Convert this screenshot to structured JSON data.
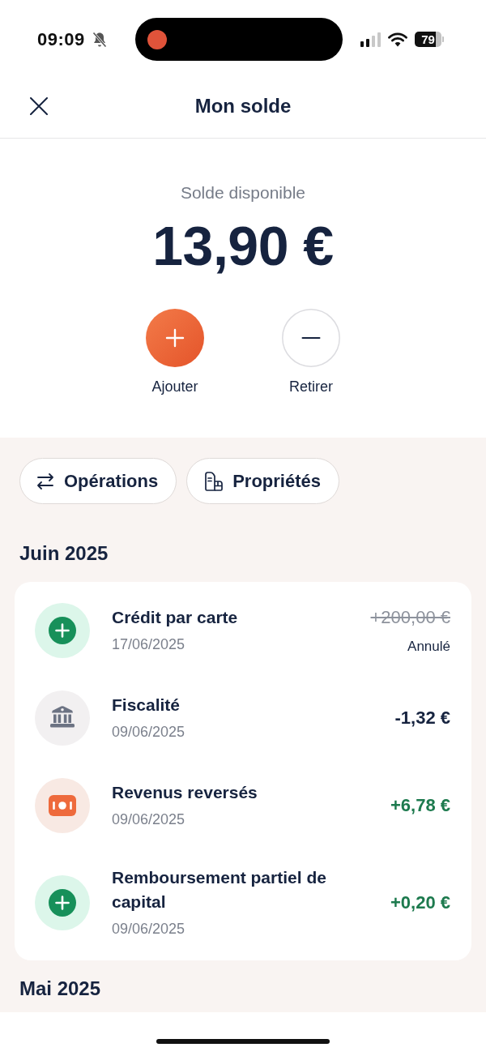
{
  "status_bar": {
    "time": "09:09",
    "battery": "79"
  },
  "header": {
    "title": "Mon solde"
  },
  "balance": {
    "label": "Solde disponible",
    "amount": "13,90 €"
  },
  "actions": [
    {
      "label": "Ajouter",
      "kind": "add"
    },
    {
      "label": "Retirer",
      "kind": "withdraw"
    }
  ],
  "shortcuts": [
    {
      "label": "Opérations",
      "kind": "operations"
    },
    {
      "label": "Propriétés",
      "kind": "properties"
    }
  ],
  "sections": [
    {
      "title": "Juin 2025",
      "transactions": [
        {
          "kind": "credit",
          "title": "Crédit par carte",
          "date": "17/06/2025",
          "amount": "+200,00 €",
          "cancelled": true,
          "status": "Annulé"
        },
        {
          "kind": "tax",
          "title": "Fiscalité",
          "date": "09/06/2025",
          "amount": "-1,32 €",
          "cancelled": false
        },
        {
          "kind": "income",
          "title": "Revenus reversés",
          "date": "09/06/2025",
          "amount": "+6,78 €",
          "cancelled": false
        },
        {
          "kind": "credit",
          "title": "Remboursement partiel de capital",
          "date": "09/06/2025",
          "amount": "+0,20 €",
          "cancelled": false
        }
      ]
    },
    {
      "title": "Mai 2025"
    }
  ]
}
